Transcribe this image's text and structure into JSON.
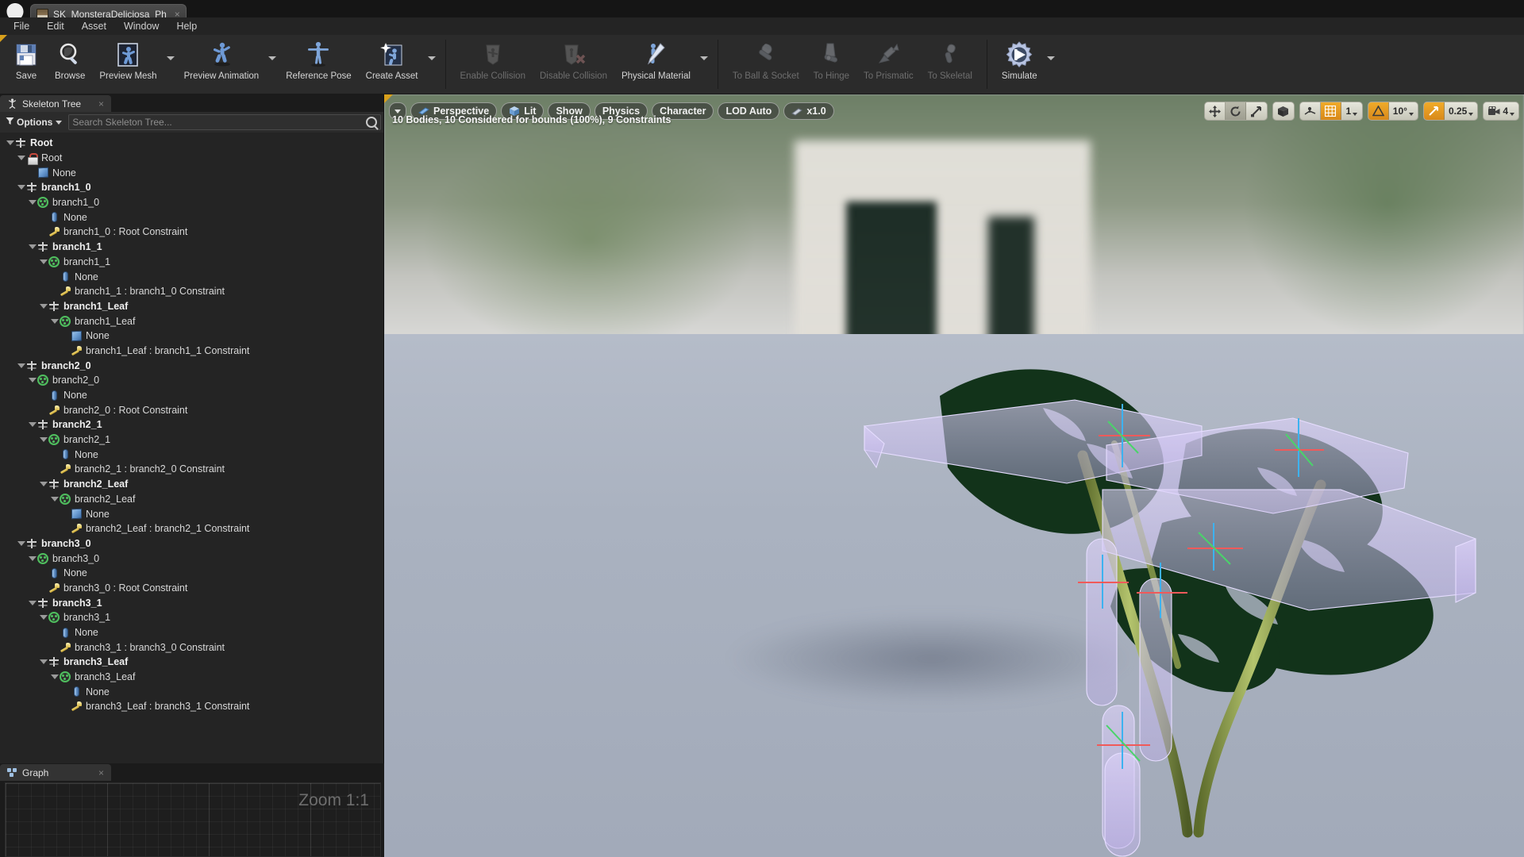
{
  "window": {
    "logo": "unreal-logo",
    "tab_title": "SK_MonsteraDeliciosa_Ph",
    "tab_close": "×"
  },
  "menubar": {
    "items": [
      "File",
      "Edit",
      "Asset",
      "Window",
      "Help"
    ]
  },
  "toolbar": {
    "groups": [
      {
        "buttons": [
          {
            "label": "Save",
            "icon": "save-icon",
            "enabled": true,
            "dropdown": false
          },
          {
            "label": "Browse",
            "icon": "browse-icon",
            "enabled": true,
            "dropdown": false
          },
          {
            "label": "Preview Mesh",
            "icon": "preview-mesh-icon",
            "enabled": true,
            "dropdown": true
          },
          {
            "label": "Preview Animation",
            "icon": "preview-animation-icon",
            "enabled": true,
            "dropdown": true
          },
          {
            "label": "Reference Pose",
            "icon": "reference-pose-icon",
            "enabled": true,
            "dropdown": false
          },
          {
            "label": "Create Asset",
            "icon": "create-asset-icon",
            "enabled": true,
            "dropdown": true
          }
        ]
      },
      {
        "buttons": [
          {
            "label": "Enable Collision",
            "icon": "enable-collision-icon",
            "enabled": false,
            "dropdown": false
          },
          {
            "label": "Disable Collision",
            "icon": "disable-collision-icon",
            "enabled": false,
            "dropdown": false
          },
          {
            "label": "Physical Material",
            "icon": "physical-material-icon",
            "enabled": true,
            "dropdown": true
          }
        ]
      },
      {
        "buttons": [
          {
            "label": "To Ball & Socket",
            "icon": "to-ball-socket-icon",
            "enabled": false,
            "dropdown": false
          },
          {
            "label": "To Hinge",
            "icon": "to-hinge-icon",
            "enabled": false,
            "dropdown": false
          },
          {
            "label": "To Prismatic",
            "icon": "to-prismatic-icon",
            "enabled": false,
            "dropdown": false
          },
          {
            "label": "To Skeletal",
            "icon": "to-skeletal-icon",
            "enabled": false,
            "dropdown": false
          }
        ]
      },
      {
        "buttons": [
          {
            "label": "Simulate",
            "icon": "simulate-icon",
            "enabled": true,
            "dropdown": true
          }
        ]
      }
    ]
  },
  "skeleton_tree": {
    "tab_label": "Skeleton Tree",
    "tab_icon": "skeleton-icon",
    "tab_close": "×",
    "options_label": "Options",
    "search_placeholder": "Search Skeleton Tree...",
    "search_value": "",
    "search_icon": "search-icon",
    "rows": [
      {
        "label": "Root",
        "depth": 0,
        "icon": "bone",
        "bold": true,
        "disc": true
      },
      {
        "label": "Root",
        "depth": 1,
        "icon": "lock",
        "bold": false,
        "disc": true
      },
      {
        "label": "None",
        "depth": 2,
        "icon": "box",
        "bold": false,
        "disc": false
      },
      {
        "label": "branch1_0",
        "depth": 1,
        "icon": "bone",
        "bold": true,
        "disc": true
      },
      {
        "label": "branch1_0",
        "depth": 2,
        "icon": "body",
        "bold": false,
        "disc": true
      },
      {
        "label": "None",
        "depth": 3,
        "icon": "capsule",
        "bold": false,
        "disc": false
      },
      {
        "label": "branch1_0 : Root Constraint",
        "depth": 3,
        "icon": "constraint",
        "bold": false,
        "disc": false
      },
      {
        "label": "branch1_1",
        "depth": 2,
        "icon": "bone",
        "bold": true,
        "disc": true
      },
      {
        "label": "branch1_1",
        "depth": 3,
        "icon": "body",
        "bold": false,
        "disc": true
      },
      {
        "label": "None",
        "depth": 4,
        "icon": "capsule",
        "bold": false,
        "disc": false
      },
      {
        "label": "branch1_1 : branch1_0 Constraint",
        "depth": 4,
        "icon": "constraint",
        "bold": false,
        "disc": false
      },
      {
        "label": "branch1_Leaf",
        "depth": 3,
        "icon": "bone",
        "bold": true,
        "disc": true
      },
      {
        "label": "branch1_Leaf",
        "depth": 4,
        "icon": "body",
        "bold": false,
        "disc": true
      },
      {
        "label": "None",
        "depth": 5,
        "icon": "box",
        "bold": false,
        "disc": false
      },
      {
        "label": "branch1_Leaf : branch1_1 Constraint",
        "depth": 5,
        "icon": "constraint",
        "bold": false,
        "disc": false
      },
      {
        "label": "branch2_0",
        "depth": 1,
        "icon": "bone",
        "bold": true,
        "disc": true
      },
      {
        "label": "branch2_0",
        "depth": 2,
        "icon": "body",
        "bold": false,
        "disc": true
      },
      {
        "label": "None",
        "depth": 3,
        "icon": "capsule",
        "bold": false,
        "disc": false
      },
      {
        "label": "branch2_0 : Root Constraint",
        "depth": 3,
        "icon": "constraint",
        "bold": false,
        "disc": false
      },
      {
        "label": "branch2_1",
        "depth": 2,
        "icon": "bone",
        "bold": true,
        "disc": true
      },
      {
        "label": "branch2_1",
        "depth": 3,
        "icon": "body",
        "bold": false,
        "disc": true
      },
      {
        "label": "None",
        "depth": 4,
        "icon": "capsule",
        "bold": false,
        "disc": false
      },
      {
        "label": "branch2_1 : branch2_0 Constraint",
        "depth": 4,
        "icon": "constraint",
        "bold": false,
        "disc": false
      },
      {
        "label": "branch2_Leaf",
        "depth": 3,
        "icon": "bone",
        "bold": true,
        "disc": true
      },
      {
        "label": "branch2_Leaf",
        "depth": 4,
        "icon": "body",
        "bold": false,
        "disc": true
      },
      {
        "label": "None",
        "depth": 5,
        "icon": "box",
        "bold": false,
        "disc": false
      },
      {
        "label": "branch2_Leaf : branch2_1 Constraint",
        "depth": 5,
        "icon": "constraint",
        "bold": false,
        "disc": false
      },
      {
        "label": "branch3_0",
        "depth": 1,
        "icon": "bone",
        "bold": true,
        "disc": true
      },
      {
        "label": "branch3_0",
        "depth": 2,
        "icon": "body",
        "bold": false,
        "disc": true
      },
      {
        "label": "None",
        "depth": 3,
        "icon": "capsule",
        "bold": false,
        "disc": false
      },
      {
        "label": "branch3_0 : Root Constraint",
        "depth": 3,
        "icon": "constraint",
        "bold": false,
        "disc": false
      },
      {
        "label": "branch3_1",
        "depth": 2,
        "icon": "bone",
        "bold": true,
        "disc": true
      },
      {
        "label": "branch3_1",
        "depth": 3,
        "icon": "body",
        "bold": false,
        "disc": true
      },
      {
        "label": "None",
        "depth": 4,
        "icon": "capsule",
        "bold": false,
        "disc": false
      },
      {
        "label": "branch3_1 : branch3_0 Constraint",
        "depth": 4,
        "icon": "constraint",
        "bold": false,
        "disc": false
      },
      {
        "label": "branch3_Leaf",
        "depth": 3,
        "icon": "bone",
        "bold": true,
        "disc": true
      },
      {
        "label": "branch3_Leaf",
        "depth": 4,
        "icon": "body",
        "bold": false,
        "disc": true
      },
      {
        "label": "None",
        "depth": 5,
        "icon": "capsule",
        "bold": false,
        "disc": false
      },
      {
        "label": "branch3_Leaf : branch3_1 Constraint",
        "depth": 5,
        "icon": "constraint",
        "bold": false,
        "disc": false
      }
    ]
  },
  "graph_panel": {
    "tab_label": "Graph",
    "tab_icon": "graph-icon",
    "tab_close": "×",
    "zoom_label": "Zoom 1:1"
  },
  "viewport": {
    "menu_caret": "viewport-options-caret",
    "pills": [
      {
        "label": "Perspective",
        "icon": "camera-icon"
      },
      {
        "label": "Lit",
        "icon": "cube-icon"
      },
      {
        "label": "Show",
        "icon": ""
      },
      {
        "label": "Physics",
        "icon": ""
      },
      {
        "label": "Character",
        "icon": ""
      },
      {
        "label": "LOD Auto",
        "icon": ""
      },
      {
        "label": "x1.0",
        "icon": "playrate-icon"
      }
    ],
    "status_text": "10 Bodies, 10 Considered for bounds (100%), 9 Constraints",
    "transform_tools": [
      {
        "icon": "move-tool-icon",
        "state": "normal"
      },
      {
        "icon": "rotate-tool-icon",
        "state": "pressed"
      },
      {
        "icon": "scale-tool-icon",
        "state": "normal"
      }
    ],
    "coord_system": {
      "icon": "world-coords-icon",
      "state": "normal"
    },
    "snap_group": [
      {
        "icon": "surface-snap-icon",
        "label": "",
        "state": "normal"
      },
      {
        "icon": "grid-snap-icon",
        "label": "",
        "state": "active"
      },
      {
        "icon": "",
        "label": "1",
        "state": "normal"
      }
    ],
    "angle_group": [
      {
        "icon": "angle-snap-icon",
        "label": "",
        "state": "active-outline"
      },
      {
        "icon": "",
        "label": "10°",
        "state": "normal"
      }
    ],
    "scale_group": [
      {
        "icon": "scale-snap-icon",
        "label": "",
        "state": "active"
      },
      {
        "icon": "",
        "label": "0.25",
        "state": "normal"
      }
    ],
    "camera_group": [
      {
        "icon": "camera-speed-icon",
        "label": "4",
        "state": "normal"
      }
    ]
  },
  "colors": {
    "accent_orange": "#d8901c",
    "panel_bg": "#242424",
    "toolbar_bg": "#2b2b2b",
    "titlebar_bg": "#151515",
    "collision_purple": "#cec1f3",
    "leaf_green": "#12331a",
    "stem_green": "#a9bb63"
  }
}
